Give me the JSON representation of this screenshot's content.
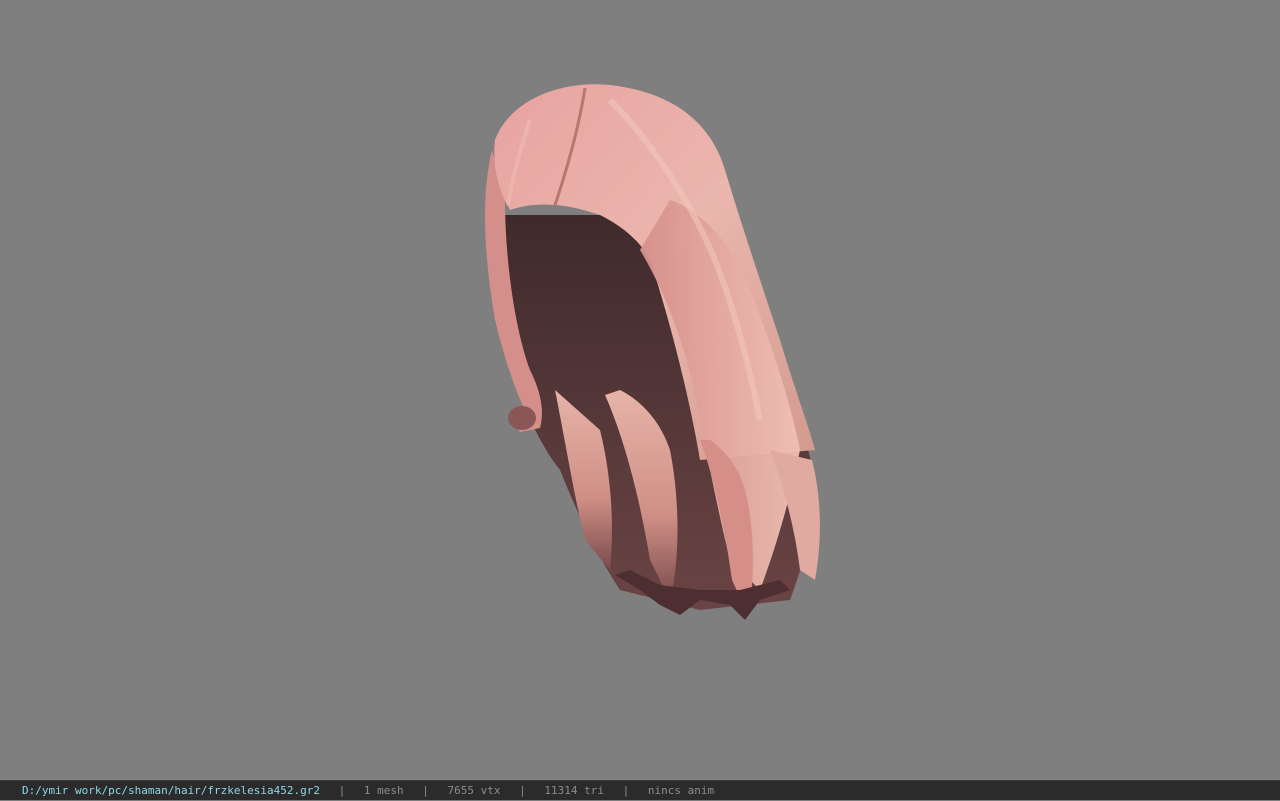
{
  "viewport": {
    "background_color": "#7f7f7f",
    "model_name": "hair-mesh"
  },
  "status": {
    "path": "D:/ymir work/pc/shaman/hair/frzkelesia452.gr2",
    "meshes": "1 mesh",
    "vertices": "7655 vtx",
    "triangles": "11314 tri",
    "animation": "nincs anim",
    "separator": "|"
  },
  "colors": {
    "hair_light": "#e6a7a0",
    "hair_mid": "#c98580",
    "hair_dark": "#5a3c3c",
    "path_text": "#8fd6ea"
  }
}
